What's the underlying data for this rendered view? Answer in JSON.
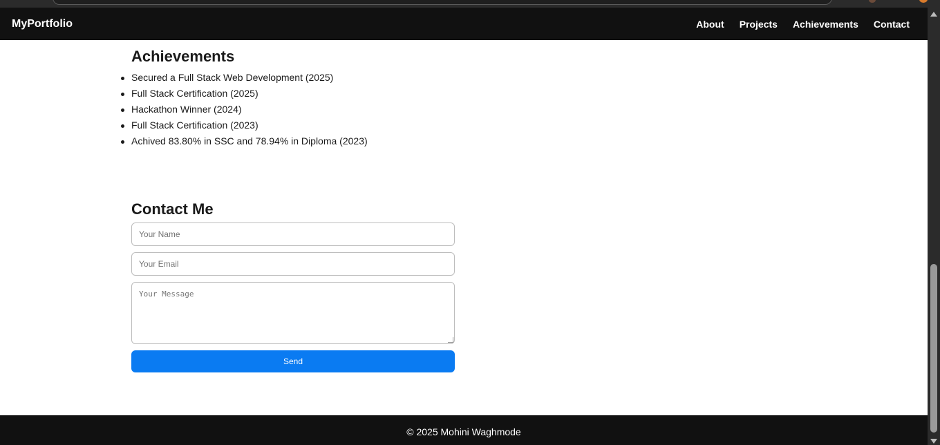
{
  "navbar": {
    "brand": "MyPortfolio",
    "links": [
      "About",
      "Projects",
      "Achievements",
      "Contact"
    ]
  },
  "achievements": {
    "title": "Achievements",
    "items": [
      "Secured a Full Stack Web Development (2025)",
      "Full Stack Certification (2025)",
      "Hackathon Winner (2024)",
      "Full Stack Certification (2023)",
      "Achived 83.80% in SSC and 78.94% in Diploma (2023)"
    ]
  },
  "contact": {
    "title": "Contact Me",
    "name_placeholder": "Your Name",
    "email_placeholder": "Your Email",
    "message_placeholder": "Your Message",
    "send_label": "Send"
  },
  "footer": {
    "text": "© 2025 Mohini Waghmode"
  },
  "colors": {
    "navbar_bg": "#111111",
    "accent": "#0a7bf2"
  }
}
